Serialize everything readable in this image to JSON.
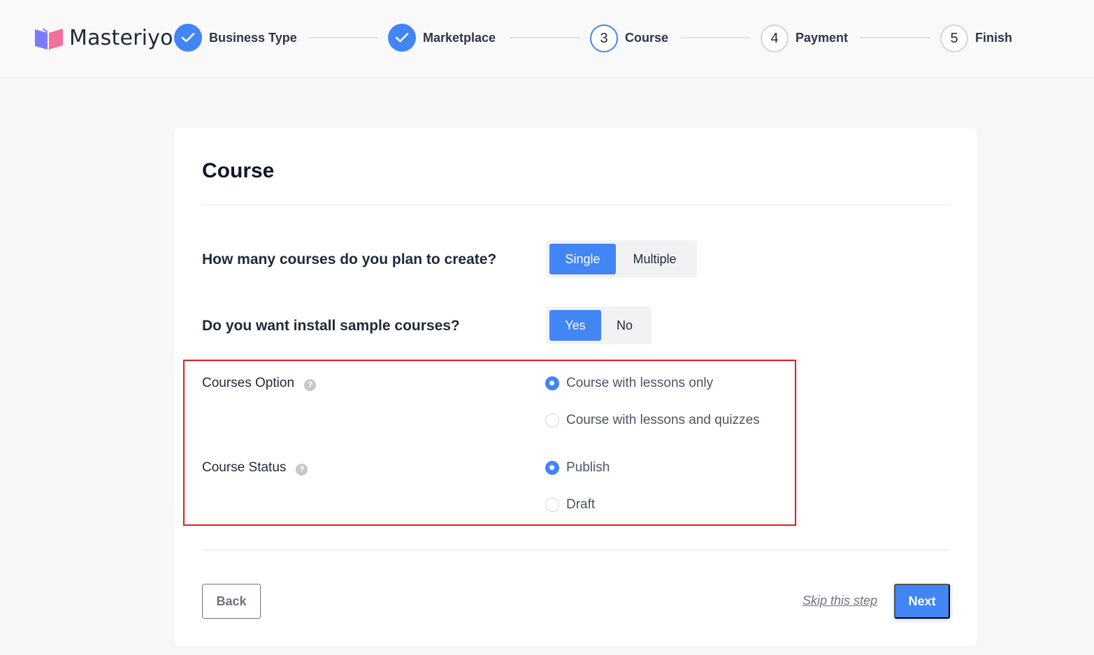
{
  "brand": {
    "name": "Masteriyo"
  },
  "steps": [
    {
      "label": "Business Type",
      "number": "1",
      "state": "done"
    },
    {
      "label": "Marketplace",
      "number": "2",
      "state": "done"
    },
    {
      "label": "Course",
      "number": "3",
      "state": "active"
    },
    {
      "label": "Payment",
      "number": "4",
      "state": "pending"
    },
    {
      "label": "Finish",
      "number": "5",
      "state": "pending"
    }
  ],
  "card": {
    "title": "Course",
    "questions": {
      "course_count": {
        "label": "How many courses do you plan to create?",
        "options": [
          "Single",
          "Multiple"
        ],
        "selected": "Single"
      },
      "sample_courses": {
        "label": "Do you want install sample courses?",
        "options": [
          "Yes",
          "No"
        ],
        "selected": "Yes"
      }
    },
    "courses_option": {
      "label": "Courses Option",
      "help": "?",
      "options": [
        "Course with lessons only",
        "Course with lessons and quizzes"
      ],
      "selected": "Course with lessons only"
    },
    "course_status": {
      "label": "Course Status",
      "help": "?",
      "options": [
        "Publish",
        "Draft"
      ],
      "selected": "Publish"
    },
    "footer": {
      "back": "Back",
      "skip": "Skip this step",
      "next": "Next"
    }
  },
  "colors": {
    "accent": "#4285f4",
    "highlight": "#e31b1b"
  },
  "icons": {
    "check": "check-icon",
    "help": "help-circle-icon",
    "logo": "book-logo-icon"
  }
}
